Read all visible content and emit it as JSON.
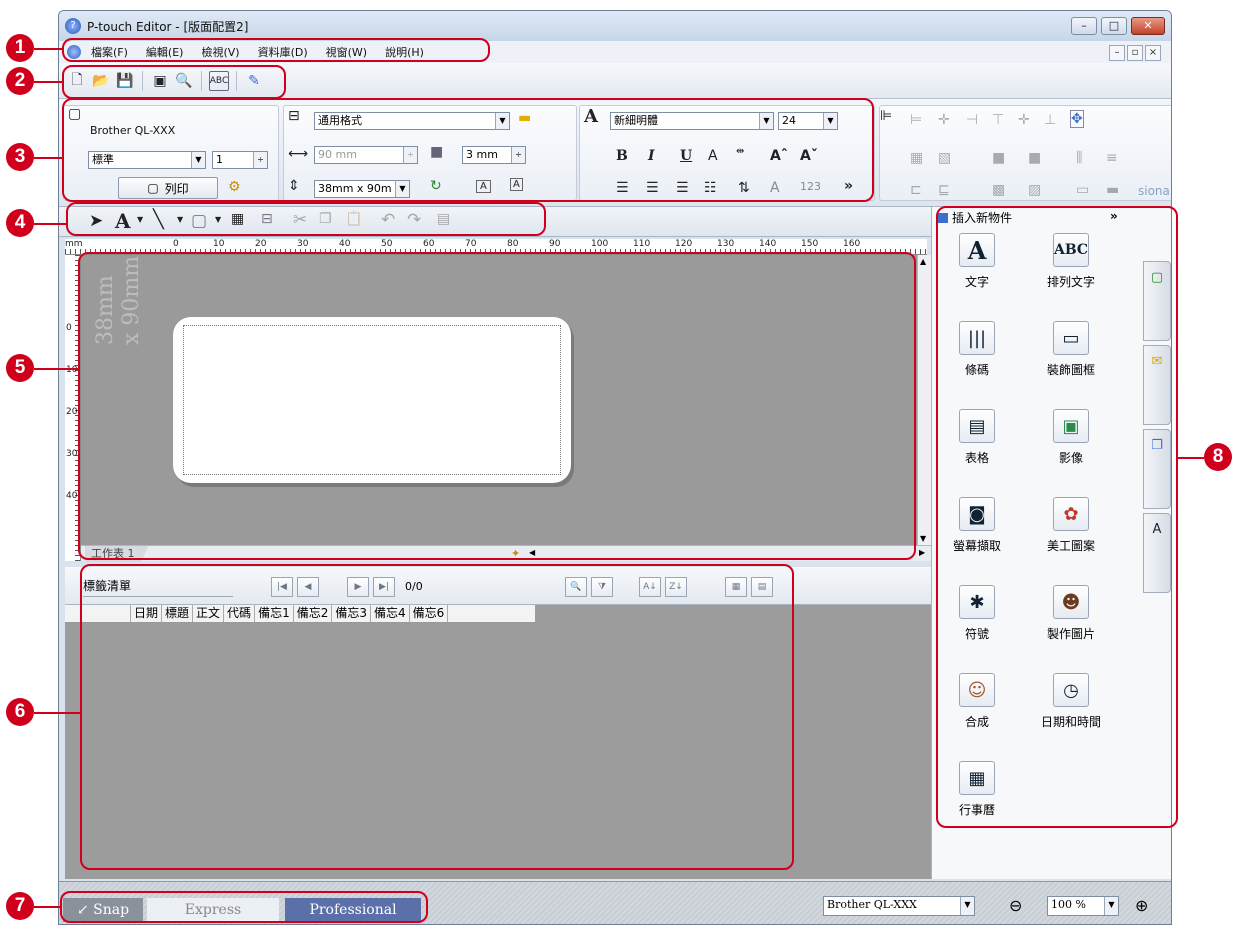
{
  "window": {
    "title": "P-touch Editor - [版面配置2]",
    "min": "–",
    "max": "□",
    "close": "✕"
  },
  "menu": {
    "items": [
      "檔案(F)",
      "編輯(E)",
      "檢視(V)",
      "資料庫(D)",
      "視窗(W)",
      "說明(H)"
    ],
    "mdi": [
      "–",
      "▫",
      "×"
    ]
  },
  "printer_panel": {
    "printer": "Brother QL-XXX",
    "mode": "標準",
    "copies": "1",
    "print_label": "列印"
  },
  "format_panel": {
    "style": "通用格式",
    "length": "90 mm",
    "margin": "3 mm",
    "tape": "38mm x 90m"
  },
  "font_panel": {
    "font": "新細明體",
    "size": "24",
    "bold": "B",
    "italic": "I",
    "underline": "U",
    "more": "»"
  },
  "right_cut_text": "sional",
  "ruler": {
    "unit": "mm",
    "h_ticks": [
      "0",
      "10",
      "20",
      "30",
      "40",
      "50",
      "60",
      "70",
      "80",
      "90",
      "100",
      "110",
      "120",
      "130",
      "140",
      "150",
      "160"
    ],
    "v_ticks": [
      "0",
      "10",
      "20",
      "30",
      "40"
    ]
  },
  "canvas": {
    "size_line1": "38mm",
    "size_line2": "x 90mm",
    "sheet_tab": "工作表 1"
  },
  "database": {
    "title": "標籤清單",
    "counter": "0/0",
    "columns": [
      "日期",
      "標題",
      "正文",
      "代碼",
      "備忘1",
      "備忘2",
      "備忘3",
      "備忘4",
      "備忘6"
    ]
  },
  "insert_panel": {
    "title": "插入新物件",
    "more": "»",
    "objects": [
      {
        "label": "文字",
        "icon": "A"
      },
      {
        "label": "排列文字",
        "icon": "ABC"
      },
      {
        "label": "條碼",
        "icon": "|||"
      },
      {
        "label": "裝飾圖框",
        "icon": "▭"
      },
      {
        "label": "表格",
        "icon": "▤"
      },
      {
        "label": "影像",
        "icon": "▣"
      },
      {
        "label": "螢幕擷取",
        "icon": "◙"
      },
      {
        "label": "美工圖案",
        "icon": "✿"
      },
      {
        "label": "符號",
        "icon": "✱"
      },
      {
        "label": "製作圖片",
        "icon": "☻"
      },
      {
        "label": "合成",
        "icon": "☺"
      },
      {
        "label": "日期和時間",
        "icon": "◷"
      },
      {
        "label": "行事曆",
        "icon": "▦"
      }
    ]
  },
  "statusbar": {
    "snap": "Snap",
    "express": "Express",
    "professional": "Professional",
    "printer": "Brother QL-XXX",
    "zoom": "100 %"
  },
  "callouts": [
    "1",
    "2",
    "3",
    "4",
    "5",
    "6",
    "7",
    "8"
  ],
  "colors": {
    "callout": "#d0001d",
    "professional_tab": "#5b6fa8"
  }
}
